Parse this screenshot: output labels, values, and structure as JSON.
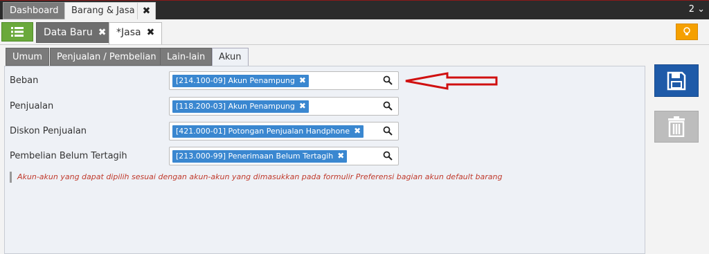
{
  "top_tabs": [
    {
      "label": "Dashboard"
    },
    {
      "label": "Barang & Jasa"
    }
  ],
  "top_close": "✖",
  "top_right": "2 ⌄",
  "doc_tabs": [
    {
      "label": "Data Baru",
      "close": "✖"
    },
    {
      "label": "*Jasa",
      "close": "✖"
    }
  ],
  "sub_tabs": [
    "Umum",
    "Penjualan / Pembelian",
    "Lain-lain",
    "Akun"
  ],
  "form": {
    "rows": [
      {
        "label": "Beban",
        "value": "[214.100-09] Akun Penampung"
      },
      {
        "label": "Penjualan",
        "value": "[118.200-03] Akun Penampung"
      },
      {
        "label": "Diskon Penjualan",
        "value": "[421.000-01] Potongan Penjualan Handphone"
      },
      {
        "label": "Pembelian Belum Tertagih",
        "value": "[213.000-99] Penerimaan Belum Tertagih"
      }
    ],
    "chip_remove": "✖",
    "hint": "Akun-akun yang dapat dipilih sesuai dengan akun-akun yang dimasukkan pada formulir Preferensi bagian akun default barang"
  },
  "colors": {
    "accent": "#1e5aa8",
    "chip": "#3a87d0",
    "green": "#6aa93b",
    "orange": "#f5a000",
    "arrow": "#d01010"
  },
  "icons": [
    "list-icon",
    "lightbulb-icon",
    "save-icon",
    "trash-icon",
    "search-icon",
    "arrow-annotation-icon"
  ]
}
